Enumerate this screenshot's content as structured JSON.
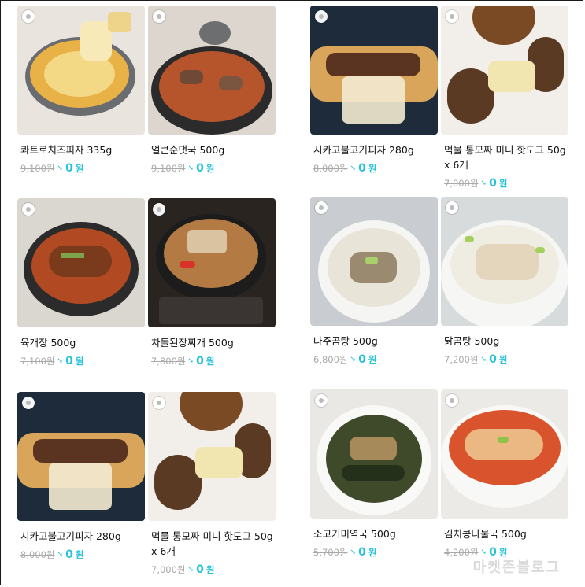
{
  "watermark": "마켓존블로그",
  "colors": {
    "accent": "#25c2d8",
    "old_price": "#aaaaaa"
  },
  "products": [
    {
      "name": "콰트로치즈피자 335g",
      "old_price": "9,100원",
      "new_price": "0",
      "unit": "원",
      "image": "cheese-pizza-image"
    },
    {
      "name": "얼큰순댓국 500g",
      "old_price": "9,100원",
      "new_price": "0",
      "unit": "원",
      "image": "sundae-soup-image"
    },
    {
      "name": "시카고불고기피자 280g",
      "old_price": "8,000원",
      "new_price": "0",
      "unit": "원",
      "image": "bulgogi-pizza-image"
    },
    {
      "name": "먹물 통모짜 미니 핫도그 50g x 6개",
      "old_price": "7,000원",
      "new_price": "0",
      "unit": "원",
      "image": "hotdog-image"
    },
    {
      "name": "육개장 500g",
      "old_price": "7,100원",
      "new_price": "0",
      "unit": "원",
      "image": "yukgaejang-image"
    },
    {
      "name": "차돌된장찌개 500g",
      "old_price": "7,800원",
      "new_price": "0",
      "unit": "원",
      "image": "doenjang-stew-image"
    },
    {
      "name": "나주곰탕 500g",
      "old_price": "6,800원",
      "new_price": "0",
      "unit": "원",
      "image": "gomtang-image"
    },
    {
      "name": "닭곰탕 500g",
      "old_price": "7,200원",
      "new_price": "0",
      "unit": "원",
      "image": "chicken-soup-image"
    },
    {
      "name": "시카고불고기피자 280g",
      "old_price": "8,000원",
      "new_price": "0",
      "unit": "원",
      "image": "bulgogi-pizza-image"
    },
    {
      "name": "먹물 통모짜 미니 핫도그 50g x 6개",
      "old_price": "7,000원",
      "new_price": "0",
      "unit": "원",
      "image": "hotdog-image"
    },
    {
      "name": "소고기미역국 500g",
      "old_price": "5,700원",
      "new_price": "0",
      "unit": "원",
      "image": "seaweed-soup-image"
    },
    {
      "name": "김치콩나물국 500g",
      "old_price": "4,200원",
      "new_price": "0",
      "unit": "원",
      "image": "kimchi-sprout-soup-image"
    }
  ]
}
